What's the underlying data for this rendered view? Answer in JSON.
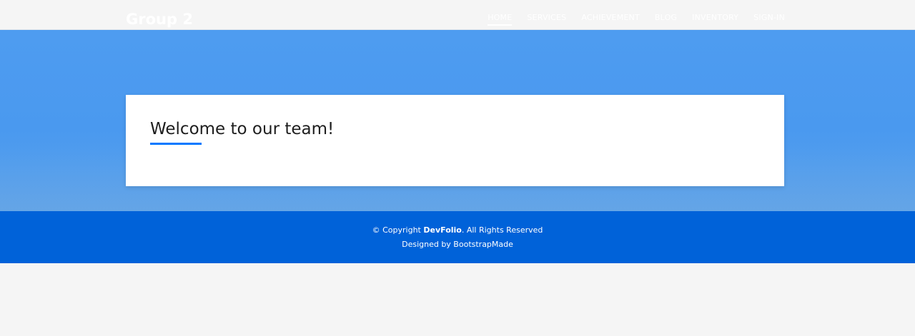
{
  "brand": "Group 2",
  "nav": {
    "items": [
      {
        "label": "HOME"
      },
      {
        "label": "SERVICES"
      },
      {
        "label": "ACHIEVEMENT"
      },
      {
        "label": "BLOG"
      },
      {
        "label": "INVENTORY"
      },
      {
        "label": "SIGN-IN"
      }
    ],
    "active": "HOME"
  },
  "card": {
    "title": "Welcome to our team!"
  },
  "footer": {
    "copyright_prefix": "© Copyright",
    "brand_name": "DevFolio",
    "copyright_suffix": ". All Rights Reserved",
    "designed_by": "Designed by BootstrapMade"
  },
  "colors": {
    "accent": "#0078ff",
    "hero": "#4a99ef",
    "footer": "#0062d9",
    "page_background": "#f5f5f5"
  }
}
